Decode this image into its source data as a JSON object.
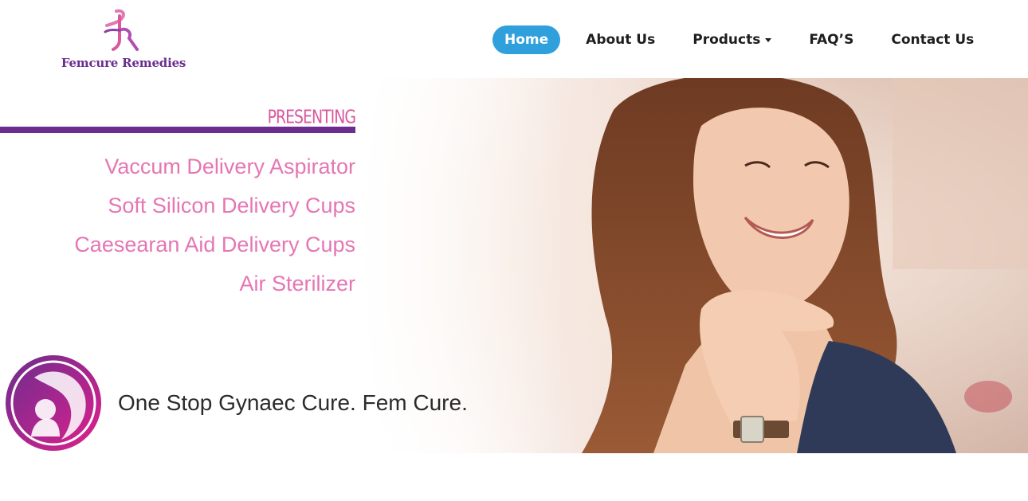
{
  "brand": {
    "name": "Femcure Remedies",
    "colors": {
      "purple": "#6b2d8f",
      "pink": "#e576b4",
      "magenta": "#d9589e",
      "accent": "#2fa0dc"
    }
  },
  "nav": {
    "items": [
      {
        "label": "Home",
        "active": true
      },
      {
        "label": "About Us",
        "active": false
      },
      {
        "label": "Products",
        "active": false,
        "dropdown": true
      },
      {
        "label": "FAQ’S",
        "active": false
      },
      {
        "label": "Contact Us",
        "active": false
      }
    ]
  },
  "hero": {
    "presenting": "PRESENTING",
    "products": [
      "Vaccum Delivery Aspirator",
      "Soft Silicon Delivery Cups",
      "Caesearan Aid Delivery Cups",
      "Air Sterilizer"
    ],
    "tagline": "One Stop Gynaec Cure. Fem Cure."
  }
}
